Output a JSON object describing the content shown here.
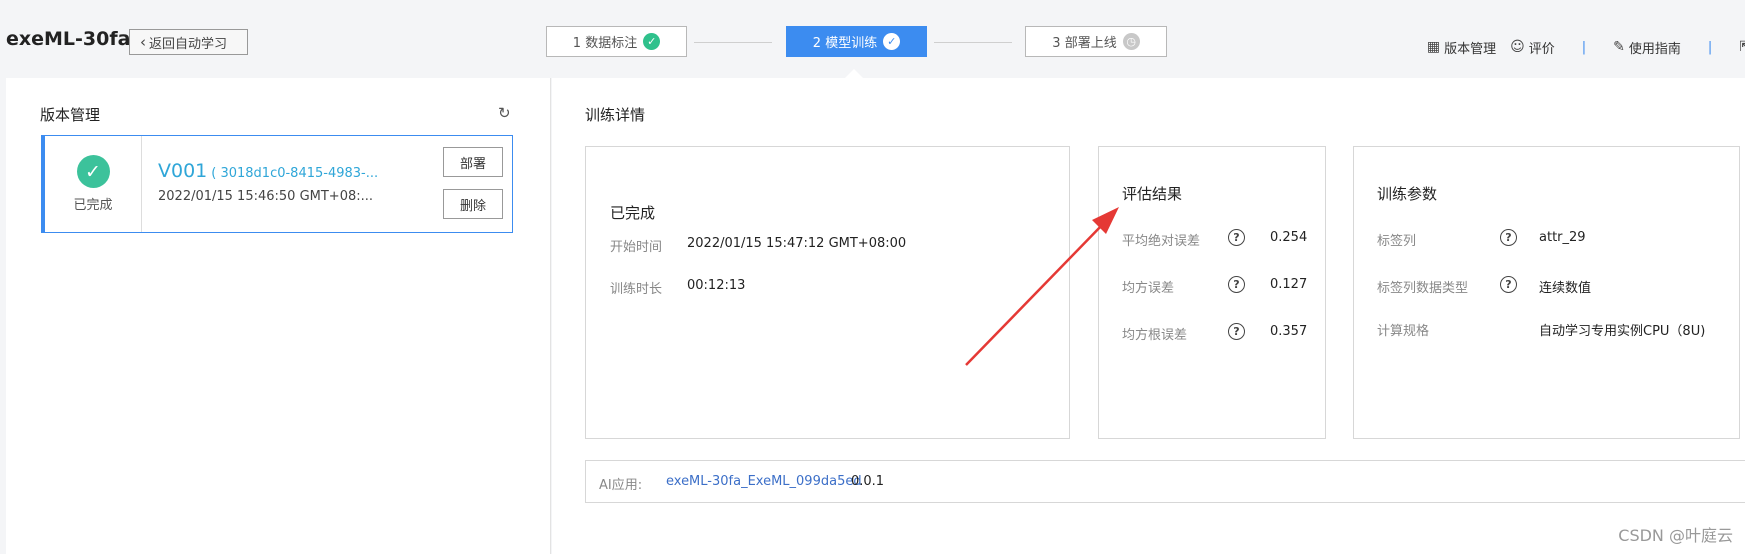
{
  "header": {
    "title": "exeML-30fa",
    "back_label": "返回自动学习",
    "steps": [
      {
        "label": "1 数据标注",
        "state": "done"
      },
      {
        "label": "2 模型训练",
        "state": "active"
      },
      {
        "label": "3 部署上线",
        "state": "pending"
      }
    ],
    "links": {
      "version_mgmt": "版本管理",
      "rate": "评价",
      "guide": "使用指南"
    }
  },
  "left": {
    "title": "版本管理",
    "version": {
      "status": "已完成",
      "name": "V001",
      "id": "( 3018d1c0-8415-4983-...",
      "time": "2022/01/15 15:46:50 GMT+08:...",
      "deploy_label": "部署",
      "delete_label": "删除"
    }
  },
  "right": {
    "title": "训练详情",
    "status": {
      "title": "已完成",
      "start_label": "开始时间",
      "start_value": "2022/01/15 15:47:12 GMT+08:00",
      "duration_label": "训练时长",
      "duration_value": "00:12:13"
    },
    "eval": {
      "title": "评估结果",
      "metrics": [
        {
          "label": "平均绝对误差",
          "value": "0.254"
        },
        {
          "label": "均方误差",
          "value": "0.127"
        },
        {
          "label": "均方根误差",
          "value": "0.357"
        }
      ]
    },
    "params": {
      "title": "训练参数",
      "label_col_label": "标签列",
      "label_col_value": "attr_29",
      "label_type_label": "标签列数据类型",
      "label_type_value": "连续数值",
      "compute_label": "计算规格",
      "compute_value": "自动学习专用实例CPU（8U)"
    },
    "ai_app": {
      "label": "AI应用:",
      "link": "exeML-30fa_ExeML_099da5ed",
      "version": "0.0.1"
    }
  },
  "watermark": "CSDN @叶庭云",
  "colors": {
    "accent": "#3c8cf0",
    "success": "#3cc29b",
    "annotation_arrow": "#e53935"
  }
}
